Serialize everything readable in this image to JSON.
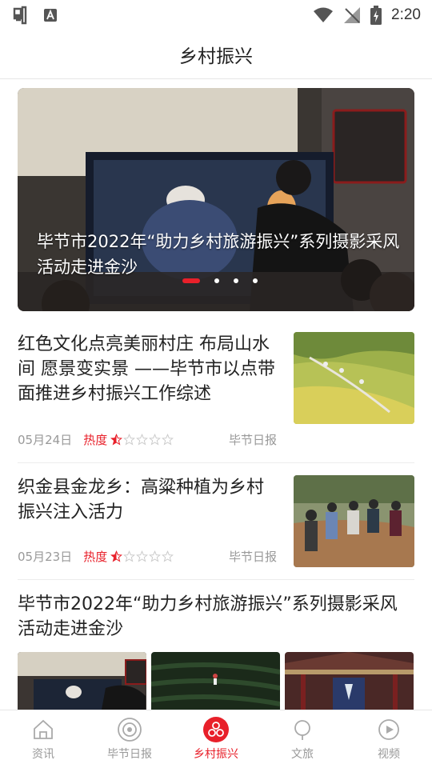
{
  "status_bar": {
    "time": "2:20"
  },
  "header": {
    "title": "乡村振兴"
  },
  "banner": {
    "caption": "毕节市2022年“助力乡村旅游振兴”系列摄影采风活动走进金沙",
    "slide_count": 4,
    "active_slide": 0
  },
  "articles": [
    {
      "title": "红色文化点亮美丽村庄 布局山水间 愿景变实景 ——毕节市以点带面推进乡村振兴工作综述",
      "date": "05月24日",
      "heat_label": "热度",
      "heat_stars": 0.5,
      "source": "毕节日报"
    },
    {
      "title": "织金县金龙乡：高粱种植为乡村振兴注入活力",
      "date": "05月23日",
      "heat_label": "热度",
      "heat_stars": 0.5,
      "source": "毕节日报"
    }
  ],
  "gallery_article": {
    "title": "毕节市2022年“助力乡村旅游振兴”系列摄影采风活动走进金沙"
  },
  "bottom_nav": {
    "items": [
      {
        "label": "资讯",
        "icon": "home-icon"
      },
      {
        "label": "毕节日报",
        "icon": "newspaper-icon"
      },
      {
        "label": "乡村振兴",
        "icon": "rural-icon",
        "active": true
      },
      {
        "label": "文旅",
        "icon": "culture-icon"
      },
      {
        "label": "视频",
        "icon": "video-icon"
      }
    ]
  },
  "colors": {
    "accent": "#e8202a",
    "text": "#222222",
    "muted": "#999999"
  }
}
